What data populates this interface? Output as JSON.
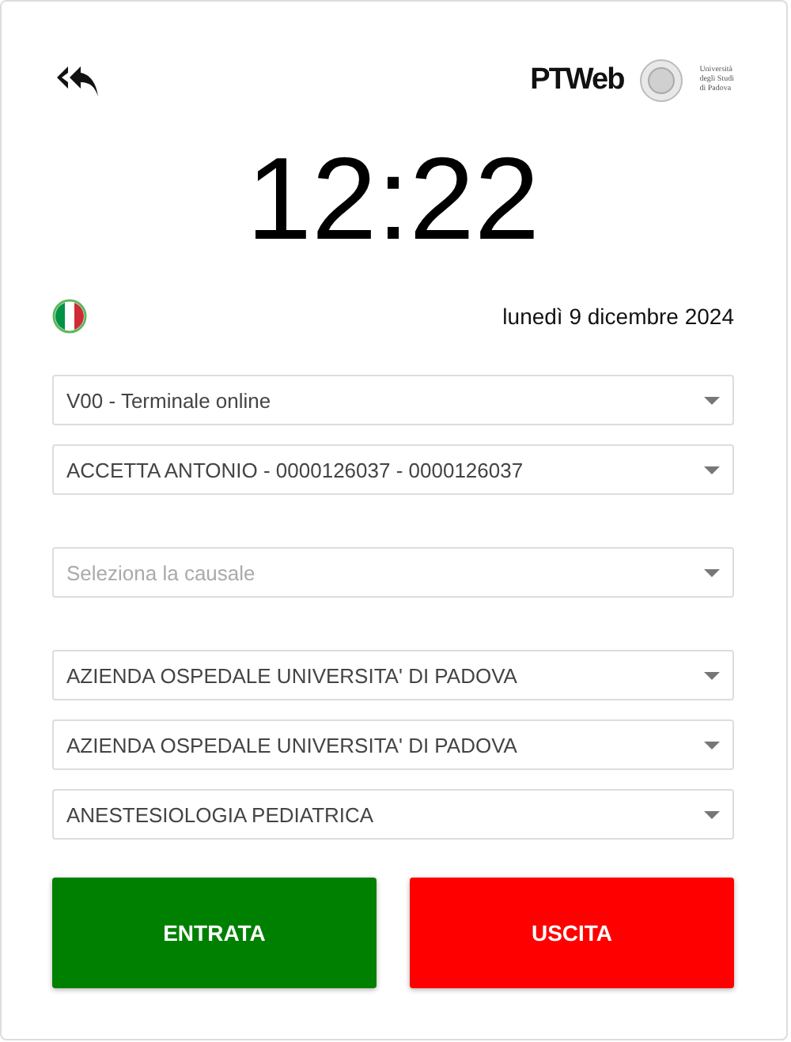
{
  "header": {
    "logo": "PTWeb",
    "university": [
      "Università",
      "degli Studi",
      "di Padova"
    ]
  },
  "clock": "12:22",
  "date": "lunedì 9 dicembre 2024",
  "selects": [
    {
      "kind": "value",
      "text": "V00 - Terminale online"
    },
    {
      "kind": "value",
      "text": "ACCETTA ANTONIO - 0000126037 - 0000126037"
    },
    {
      "kind": "placeholder",
      "text": "Seleziona la causale"
    },
    {
      "kind": "value",
      "text": "AZIENDA OSPEDALE UNIVERSITA' DI PADOVA"
    },
    {
      "kind": "value",
      "text": "AZIENDA OSPEDALE UNIVERSITA' DI PADOVA"
    },
    {
      "kind": "value",
      "text": "ANESTESIOLOGIA PEDIATRICA"
    }
  ],
  "buttons": [
    {
      "label": "ENTRATA",
      "color": "#008000"
    },
    {
      "label": "USCITA",
      "color": "#ff0000"
    }
  ]
}
